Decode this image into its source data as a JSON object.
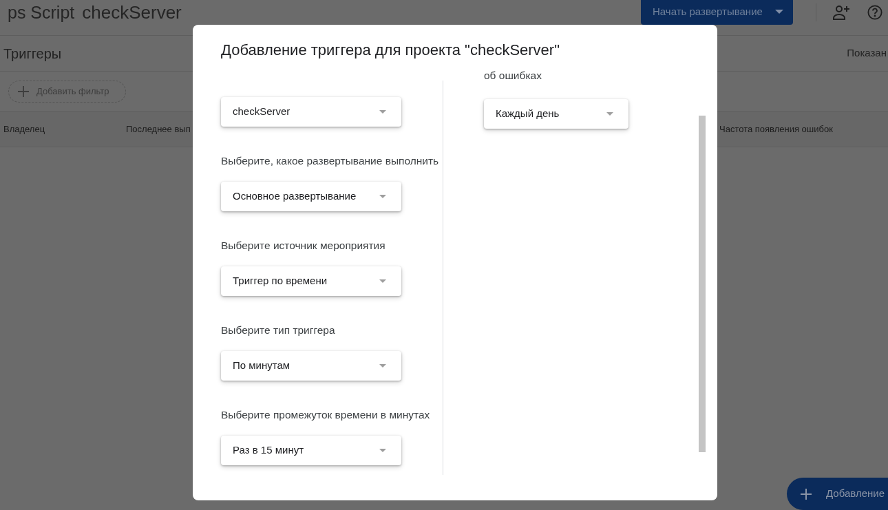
{
  "app_bar": {
    "product_name": "ps Script",
    "project_name": "checkServer",
    "deploy_button": "Начать развертывание"
  },
  "page_header": {
    "title": "Триггеры",
    "right_text": "Показан"
  },
  "filter_chip": {
    "label": "Добавить фильтр"
  },
  "table": {
    "columns": [
      "Владелец",
      "Последнее вып",
      "Частота появления ошибок"
    ]
  },
  "dialog": {
    "title": "Добавление триггера для проекта \"checkServer\"",
    "left_fields": [
      {
        "value": "checkServer"
      },
      {
        "label": "Выберите, какое развертывание выполнить",
        "value": "Основное развертывание"
      },
      {
        "label": "Выберите источник мероприятия",
        "value": "Триггер по времени"
      },
      {
        "label": "Выберите тип триггера",
        "value": "По минутам"
      },
      {
        "label": "Выберите промежуток времени в минутах",
        "value": "Раз в 15 минут"
      }
    ],
    "right_fields": [
      {
        "label": "об ошибках",
        "value": "Каждый день"
      }
    ]
  },
  "fab": {
    "label": "Добавление"
  }
}
